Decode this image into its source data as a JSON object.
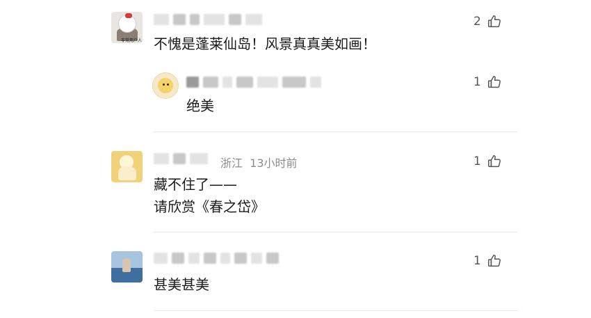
{
  "comments": [
    {
      "text": "不愧是蓬莱仙岛！风景真真美如画！",
      "likes": "2",
      "avatar_caption": "非常用户人",
      "reply": {
        "text": "绝美",
        "likes": "1"
      }
    },
    {
      "location": "浙江",
      "time": "13小时前",
      "text_line1": "藏不住了——",
      "text_line2": "请欣赏《春之岱》",
      "likes": "1"
    },
    {
      "text": "甚美甚美",
      "likes": "1"
    }
  ],
  "icons": {
    "like": "thumbs-up-icon"
  }
}
